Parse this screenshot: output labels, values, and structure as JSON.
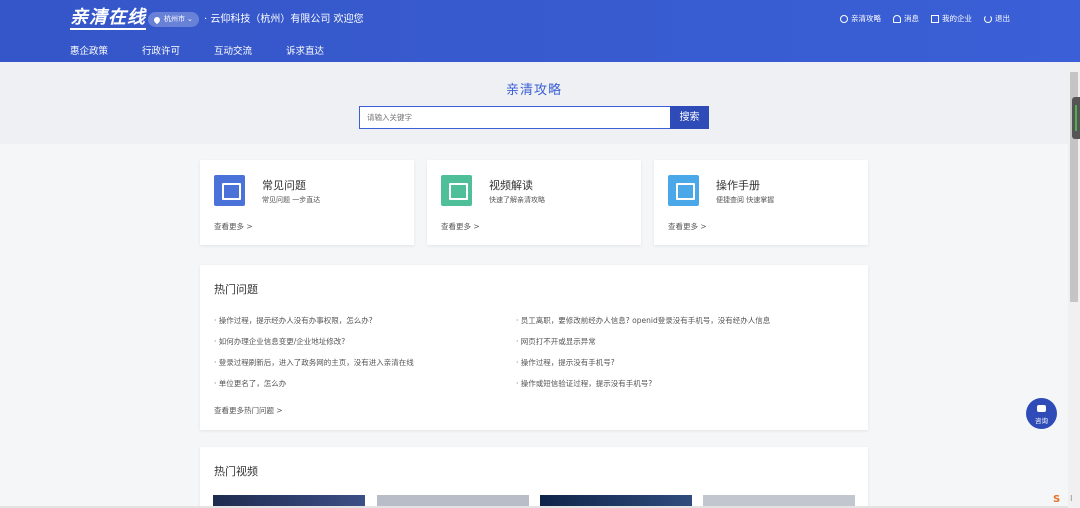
{
  "header": {
    "logo": "亲清在线",
    "city": "杭州市",
    "company_prefix": "·",
    "company": "云仰科技（杭州）有限公司 欢迎您",
    "nav": [
      "惠企政策",
      "行政许可",
      "互动交流",
      "诉求直达"
    ],
    "actions": [
      {
        "label": "亲清攻略",
        "icon": "help-circle-icon"
      },
      {
        "label": "消息",
        "icon": "bell-icon"
      },
      {
        "label": "我的企业",
        "icon": "building-icon"
      },
      {
        "label": "退出",
        "icon": "power-icon"
      }
    ]
  },
  "hero": {
    "title": "亲清攻略",
    "search_placeholder": "请输入关键字",
    "search_button": "搜索"
  },
  "cards": [
    {
      "title": "常见问题",
      "subtitle": "常见问题 一步直达",
      "more": "查看更多 >",
      "icon": "faq-icon",
      "color": "#4a72d9"
    },
    {
      "title": "视频解读",
      "subtitle": "快速了解亲清攻略",
      "more": "查看更多 >",
      "icon": "video-icon",
      "color": "#4fbf9a"
    },
    {
      "title": "操作手册",
      "subtitle": "便捷查阅 快速掌握",
      "more": "查看更多 >",
      "icon": "manual-icon",
      "color": "#4aa8e8"
    }
  ],
  "hot_questions": {
    "title": "热门问题",
    "left": [
      "操作过程，提示经办人没有办事权限，怎么办?",
      "如何办理企业信息变更/企业地址修改?",
      "登录过程刷新后，进入了政务网的主页，没有进入亲清在线",
      "单位更名了，怎么办"
    ],
    "right": [
      "员工离职，要修改前经办人信息? openid登录没有手机号，没有经办人信息",
      "网页打不开或显示异常",
      "操作过程，提示没有手机号?",
      "操作或短信验证过程，提示没有手机号?"
    ],
    "more": "查看更多热门问题 >"
  },
  "hot_videos": {
    "title": "热门视频"
  },
  "consult": {
    "label": "咨询"
  },
  "corner_badge": "S"
}
